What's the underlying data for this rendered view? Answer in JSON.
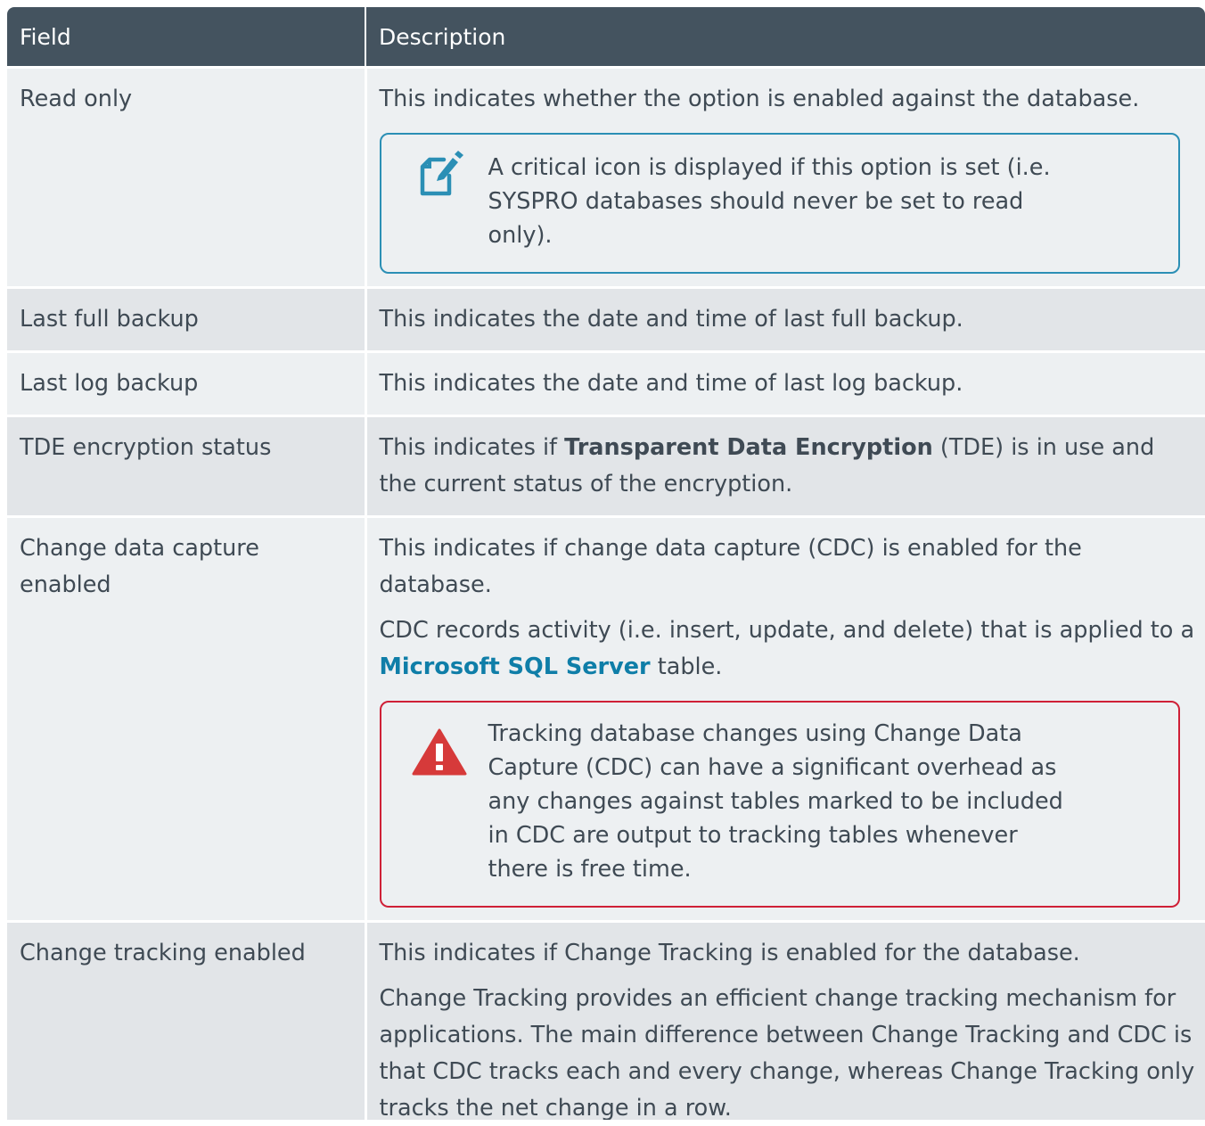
{
  "header": {
    "field": "Field",
    "description": "Description"
  },
  "rows": [
    {
      "field": "Read only",
      "description": "This indicates whether the option is enabled against the database.",
      "note": {
        "icon": "note-pencil-icon",
        "color": "#2b8fb5",
        "text": "A critical icon is displayed if this option is set (i.e. SYSPRO databases should never be set to read only)."
      }
    },
    {
      "field": "Last full backup",
      "description": "This indicates the date and time of last full backup."
    },
    {
      "field": "Last log backup",
      "description": "This indicates the date and time of last log backup."
    },
    {
      "field": "TDE encryption status",
      "description_pre": "This indicates if ",
      "description_bold": "Transparent Data Encryption",
      "description_post": " (TDE) is in use and the current status of the encryption."
    },
    {
      "field": "Change data capture enabled",
      "description": "This indicates if change data capture (CDC) is enabled for the database.",
      "description2_pre": "CDC records activity (i.e. insert, update, and delete) that is applied to a ",
      "description2_link": "Microsoft SQL Server",
      "description2_post": " table.",
      "warning": {
        "icon": "warning-triangle-icon",
        "color": "#cf2037",
        "text": "Tracking database changes using Change Data Capture (CDC) can have a significant overhead as any changes against tables marked to be included in CDC are output to tracking tables whenever there is free time."
      }
    },
    {
      "field": "Change tracking enabled",
      "description": "This indicates if Change Tracking is enabled for the database.",
      "description2": "Change Tracking provides an efficient change tracking mechanism for applications. The main difference between Change Tracking and CDC is that CDC tracks each and every change, whereas Change Tracking only tracks the net change in a row."
    }
  ],
  "colors": {
    "header_bg": "#44535f",
    "row_odd": "#edf0f2",
    "row_even": "#e2e5e8",
    "link": "#0f7ea8"
  }
}
